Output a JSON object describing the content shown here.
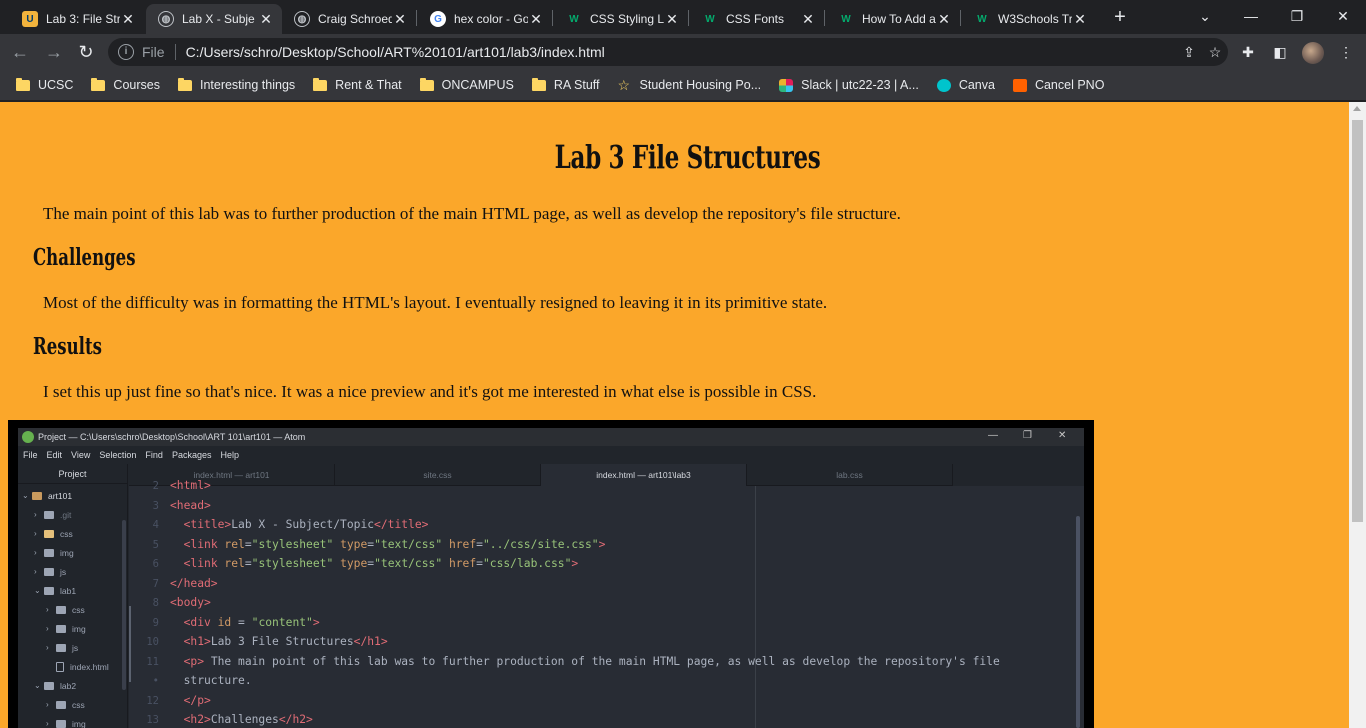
{
  "browser": {
    "tabs": [
      {
        "title": "Lab 3: File Stru",
        "icon": "ucsc-icon",
        "active": false
      },
      {
        "title": "Lab X - Subje",
        "icon": "globe-icon",
        "active": true
      },
      {
        "title": "Craig Schroed",
        "icon": "globe-icon",
        "active": false
      },
      {
        "title": "hex color - Go",
        "icon": "google-icon",
        "active": false
      },
      {
        "title": "CSS Styling Li",
        "icon": "w3schools-icon",
        "active": false
      },
      {
        "title": "CSS Fonts",
        "icon": "w3schools-icon",
        "active": false
      },
      {
        "title": "How To Add a",
        "icon": "w3schools-icon",
        "active": false
      },
      {
        "title": "W3Schools Tr",
        "icon": "w3schools-icon",
        "active": false
      }
    ],
    "address": {
      "scheme_label": "File",
      "url": "C:/Users/schro/Desktop/School/ART%20101/art101/lab3/index.html"
    },
    "bookmarks": [
      {
        "label": "UCSC",
        "icon": "folder-icon"
      },
      {
        "label": "Courses",
        "icon": "folder-icon"
      },
      {
        "label": "Interesting things",
        "icon": "folder-icon"
      },
      {
        "label": "Rent & That",
        "icon": "folder-icon"
      },
      {
        "label": "ONCAMPUS",
        "icon": "folder-icon"
      },
      {
        "label": "RA Stuff",
        "icon": "folder-icon"
      },
      {
        "label": "Student Housing Po...",
        "icon": "star-icon"
      },
      {
        "label": "Slack | utc22-23 | A...",
        "icon": "slack-icon"
      },
      {
        "label": "Canva",
        "icon": "canva-icon"
      },
      {
        "label": "Cancel PNO",
        "icon": "jotform-icon"
      }
    ]
  },
  "page": {
    "title": "Lab 3 File Structures",
    "intro": "The main point of this lab was to further production of the main HTML page, as well as develop the repository's file structure.",
    "challenges_heading": "Challenges",
    "challenges_text": "Most of the difficulty was in formatting the HTML's layout. I eventually resigned to leaving it in its primitive state.",
    "results_heading": "Results",
    "results_text": "I set this up just fine so that's nice. It was a nice preview and it's got me interested in what else is possible in CSS.",
    "background_color": "#fba72a"
  },
  "atom_screenshot": {
    "window_title": "Project — C:\\Users\\schro\\Desktop\\School\\ART 101\\art101 — Atom",
    "menu": [
      "File",
      "Edit",
      "View",
      "Selection",
      "Find",
      "Packages",
      "Help"
    ],
    "tree_header": "Project",
    "tree": [
      {
        "label": "art101",
        "kind": "repo",
        "depth": 0,
        "expanded": true
      },
      {
        "label": ".git",
        "kind": "folder",
        "depth": 1,
        "expanded": false
      },
      {
        "label": "css",
        "kind": "folder-open",
        "depth": 1,
        "expanded": false
      },
      {
        "label": "img",
        "kind": "folder",
        "depth": 1,
        "expanded": false
      },
      {
        "label": "js",
        "kind": "folder",
        "depth": 1,
        "expanded": false
      },
      {
        "label": "lab1",
        "kind": "folder",
        "depth": 1,
        "expanded": true
      },
      {
        "label": "css",
        "kind": "folder",
        "depth": 2,
        "expanded": false
      },
      {
        "label": "img",
        "kind": "folder",
        "depth": 2,
        "expanded": false
      },
      {
        "label": "js",
        "kind": "folder",
        "depth": 2,
        "expanded": false
      },
      {
        "label": "index.html",
        "kind": "file",
        "depth": 2,
        "expanded": false
      },
      {
        "label": "lab2",
        "kind": "folder",
        "depth": 1,
        "expanded": true
      },
      {
        "label": "css",
        "kind": "folder",
        "depth": 2,
        "expanded": false
      },
      {
        "label": "img",
        "kind": "folder",
        "depth": 2,
        "expanded": false
      }
    ],
    "tabs": [
      "index.html — art101",
      "site.css",
      "index.html — art101\\lab3",
      "lab.css"
    ],
    "active_tab": 2,
    "gutter": [
      "2",
      "3",
      "4",
      "5",
      "6",
      "7",
      "8",
      "9",
      "10",
      "11",
      "•",
      "12",
      "13"
    ],
    "code": [
      [
        [
          "tg",
          "<html>"
        ]
      ],
      [
        [
          "tg",
          "<head>"
        ]
      ],
      [
        [
          "pl",
          "  "
        ],
        [
          "tg",
          "<title>"
        ],
        [
          "pl",
          "Lab X - Subject/Topic"
        ],
        [
          "tg",
          "</title>"
        ]
      ],
      [
        [
          "pl",
          "  "
        ],
        [
          "tg",
          "<link "
        ],
        [
          "at",
          "rel"
        ],
        [
          "pl",
          "="
        ],
        [
          "st",
          "\"stylesheet\""
        ],
        [
          "pl",
          " "
        ],
        [
          "at",
          "type"
        ],
        [
          "pl",
          "="
        ],
        [
          "st",
          "\"text/css\""
        ],
        [
          "pl",
          " "
        ],
        [
          "at",
          "href"
        ],
        [
          "pl",
          "="
        ],
        [
          "st",
          "\"../css/site.css\""
        ],
        [
          "tg",
          ">"
        ]
      ],
      [
        [
          "pl",
          "  "
        ],
        [
          "tg",
          "<link "
        ],
        [
          "at",
          "rel"
        ],
        [
          "pl",
          "="
        ],
        [
          "st",
          "\"stylesheet\""
        ],
        [
          "pl",
          " "
        ],
        [
          "at",
          "type"
        ],
        [
          "pl",
          "="
        ],
        [
          "st",
          "\"text/css\""
        ],
        [
          "pl",
          " "
        ],
        [
          "at",
          "href"
        ],
        [
          "pl",
          "="
        ],
        [
          "st",
          "\"css/lab.css\""
        ],
        [
          "tg",
          ">"
        ]
      ],
      [
        [
          "tg",
          "</head>"
        ]
      ],
      [
        [
          "tg",
          "<body>"
        ]
      ],
      [
        [
          "pl",
          "  "
        ],
        [
          "tg",
          "<div "
        ],
        [
          "at",
          "id"
        ],
        [
          "pl",
          " = "
        ],
        [
          "st",
          "\"content\""
        ],
        [
          "tg",
          ">"
        ]
      ],
      [
        [
          "pl",
          "  "
        ],
        [
          "tg",
          "<h1>"
        ],
        [
          "pl",
          "Lab 3 File Structures"
        ],
        [
          "tg",
          "</h1>"
        ]
      ],
      [
        [
          "pl",
          "  "
        ],
        [
          "tg",
          "<p>"
        ],
        [
          "pl",
          " The main point of this lab was to further production of the main HTML page, as well as develop the repository's file"
        ]
      ],
      [
        [
          "pl",
          "  structure."
        ]
      ],
      [
        [
          "pl",
          "  "
        ],
        [
          "tg",
          "</p>"
        ]
      ],
      [
        [
          "pl",
          "  "
        ],
        [
          "tg",
          "<h2>"
        ],
        [
          "pl",
          "Challenges"
        ],
        [
          "tg",
          "</h2>"
        ]
      ]
    ]
  }
}
